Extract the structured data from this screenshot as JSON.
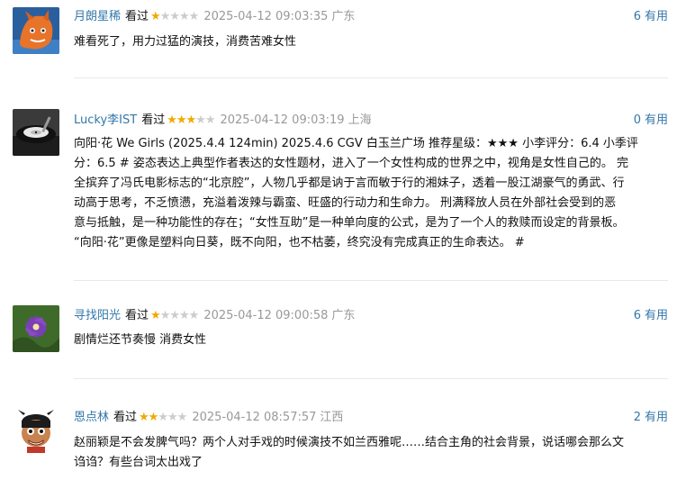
{
  "comments": [
    {
      "user": "月朗星稀",
      "status": "看过",
      "rating": 1,
      "time": "2025-04-12 09:03:35",
      "location": "广东",
      "votes": "6",
      "vote_label": "有用",
      "avatar_icon": "orange-fox-avatar",
      "lines": [
        "难看死了，用力过猛的演技，消费苦难女性"
      ]
    },
    {
      "user": "Lucky李IST",
      "status": "看过",
      "rating": 3,
      "time": "2025-04-12 09:03:19",
      "location": "上海",
      "votes": "0",
      "vote_label": "有用",
      "avatar_icon": "vinyl-record-avatar",
      "lines": [
        "向阳·花 We Girls (2025.4.4 124min) 2025.4.6 CGV 白玉兰广场 推荐星级：★★★ 小李评分：6.4 小季评",
        "分：6.5 # 姿态表达上典型作者表达的女性题材，进入了一个女性构成的世界之中，视角是女性自己的。 完",
        "全摈弃了冯氏电影标志的“北京腔”，人物几乎都是讷于言而敏于行的湘妹子，透着一股江湖豪气的勇武、行",
        "动高于思考，不乏愤懑，充溢着泼辣与霸蛮、旺盛的行动力和生命力。 刑满释放人员在外部社会受到的恶",
        "意与抵触，是一种功能性的存在；“女性互助”是一种单向度的公式，是为了一个人的救赎而设定的背景板。",
        "“向阳·花”更像是塑料向日葵，既不向阳，也不枯萎，终究没有完成真正的生命表达。 #"
      ]
    },
    {
      "user": "寻找阳光",
      "status": "看过",
      "rating": 1,
      "time": "2025-04-12 09:00:58",
      "location": "广东",
      "votes": "6",
      "vote_label": "有用",
      "avatar_icon": "purple-flower-avatar",
      "lines": [
        "剧情烂还节奏慢 消费女性"
      ]
    },
    {
      "user": "恩点林",
      "status": "看过",
      "rating": 2,
      "time": "2025-04-12 08:57:57",
      "location": "江西",
      "votes": "2",
      "vote_label": "有用",
      "avatar_icon": "cartoon-kid-avatar",
      "lines": [
        "赵丽颖是不会发脾气吗？两个人对手戏的时候演技不如兰西雅呢……结合主角的社会背景，说话哪会那么文",
        "诌诌？有些台词太出戏了"
      ]
    }
  ]
}
